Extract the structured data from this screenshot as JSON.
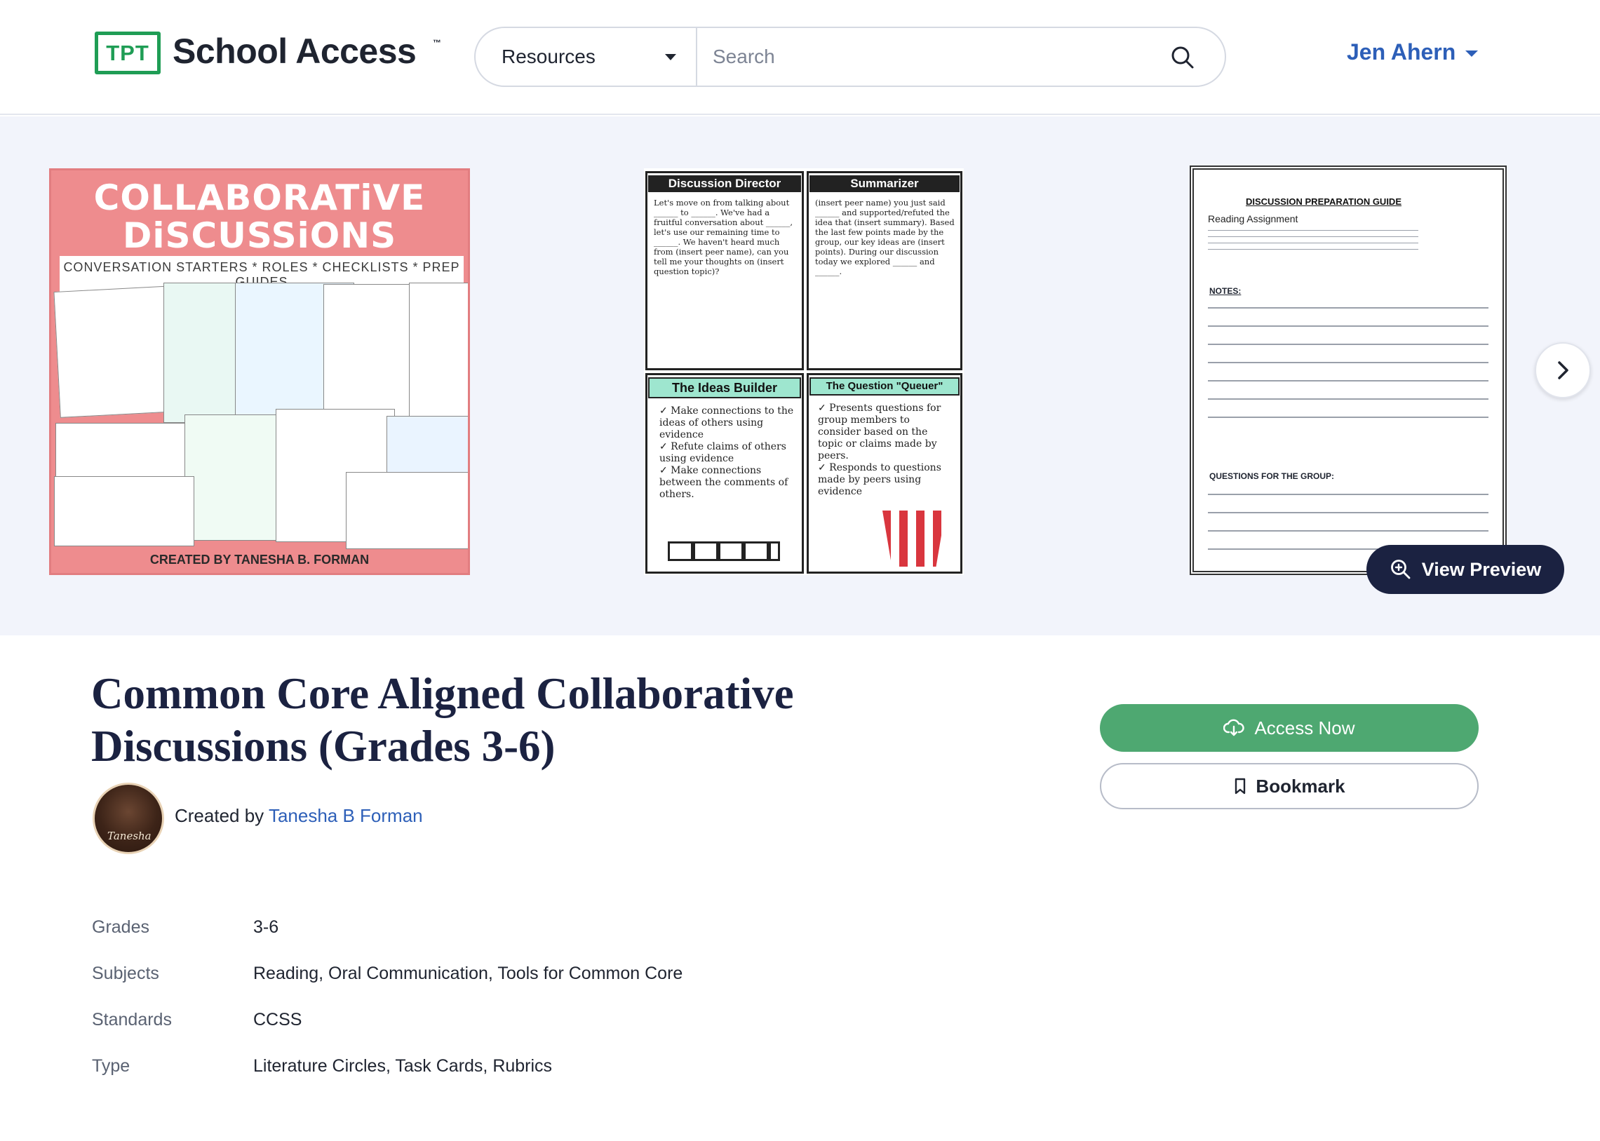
{
  "header": {
    "logo_badge": "TPT",
    "logo_text": "School Access",
    "logo_tm": "™",
    "resources_label": "Resources",
    "search_placeholder": "Search",
    "user_name": "Jen Ahern"
  },
  "gallery": {
    "cover": {
      "title_line1": "COLLABORATiVE",
      "title_line2": "DiSCUSSiONS",
      "subtitle": "CONVERSATION STARTERS * ROLES * CHECKLISTS * PREP GUIDES",
      "footer": "CREATED BY TANESHA B. FORMAN"
    },
    "role_cards": {
      "discussion_director": "Discussion Director",
      "summarizer": "Summarizer",
      "ideas_builder": "The Ideas Builder",
      "question_queuer": "The Question \"Queuer\""
    },
    "prep_guide": {
      "title": "DISCUSSION PREPARATION GUIDE",
      "reading_assignment": "Reading Assignment",
      "notes": "NOTES:",
      "questions": "QUESTIONS FOR THE GROUP:"
    },
    "view_preview_label": "View Preview"
  },
  "product": {
    "title": "Common Core Aligned Collaborative Discussions (Grades 3-6)",
    "created_by_label": "Created by",
    "author": "Tanesha B Forman",
    "avatar_signature": "Tanesha",
    "access_now_label": "Access Now",
    "bookmark_label": "Bookmark"
  },
  "details": [
    {
      "key": "Grades",
      "value": "3-6"
    },
    {
      "key": "Subjects",
      "value": "Reading, Oral Communication, Tools for Common Core"
    },
    {
      "key": "Standards",
      "value": "CCSS"
    },
    {
      "key": "Type",
      "value": "Literature Circles, Task Cards, Rubrics"
    }
  ],
  "colors": {
    "brand_green": "#1f9d55",
    "access_green": "#4ea871",
    "link_blue": "#2d5fb8",
    "navy": "#1b2241",
    "gallery_bg": "#f2f4fb",
    "cover_pink": "#ee8c8e"
  },
  "icons": {
    "search": "search-icon",
    "dropdown": "chevron-down-icon",
    "next": "chevron-right-icon",
    "preview": "zoom-in-icon",
    "download": "cloud-download-icon",
    "bookmark": "bookmark-icon"
  }
}
